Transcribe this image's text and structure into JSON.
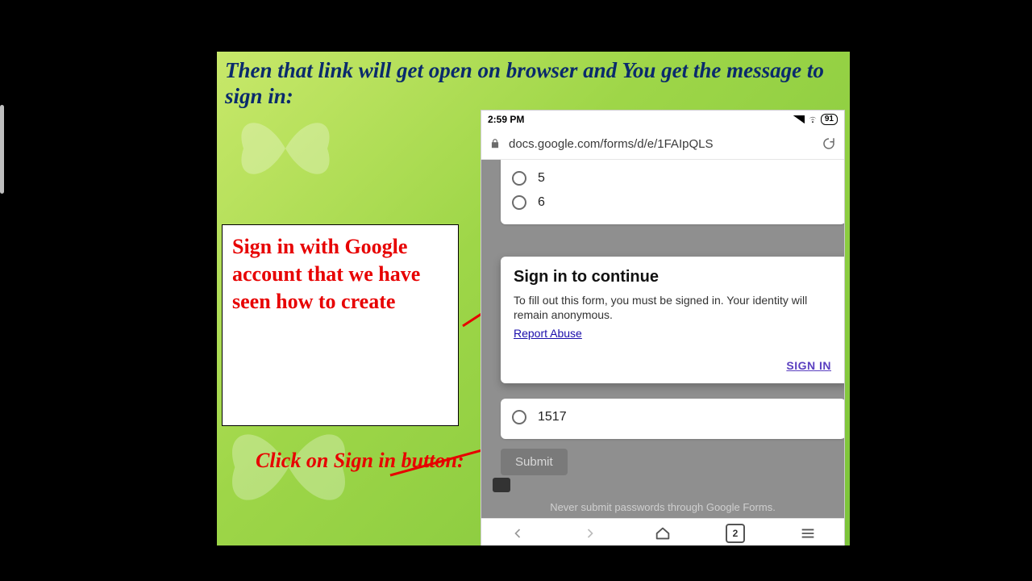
{
  "slide": {
    "title": "Then that link will get open on browser and You get the message to sign in:",
    "callout1": "Sign in with Google account that we have seen how to create",
    "callout2": "Click on Sign in button:"
  },
  "phone": {
    "status": {
      "time": "2:59 PM",
      "battery": "91"
    },
    "urlbar": {
      "url": "docs.google.com/forms/d/e/1FAIpQLS"
    },
    "form": {
      "options_top": [
        "5",
        "6"
      ],
      "options_bottom": [
        "1517"
      ],
      "submit": "Submit",
      "warning": "Never submit passwords through Google Forms."
    },
    "prompt": {
      "heading": "Sign in to continue",
      "body": "To fill out this form, you must be signed in. Your identity will remain anonymous.",
      "report": "Report Abuse",
      "signin": "SIGN IN"
    },
    "nav": {
      "tabs": "2"
    }
  }
}
